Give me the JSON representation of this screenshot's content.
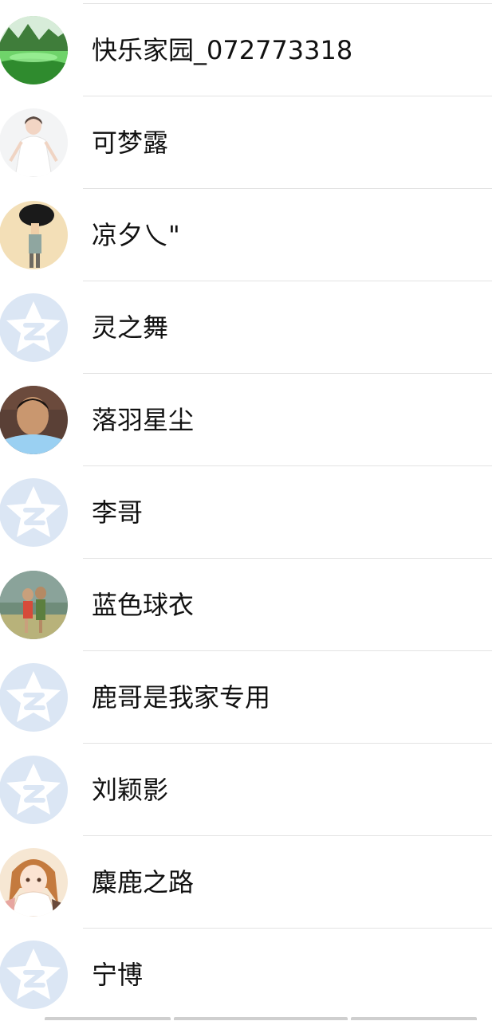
{
  "contacts": [
    {
      "name": "快乐家园_072773318",
      "avatar": "landscape-photo-avatar"
    },
    {
      "name": "可梦露",
      "avatar": "girl-white-dress-avatar"
    },
    {
      "name": "凉夕乀\"",
      "avatar": "cartoon-boy-avatar"
    },
    {
      "name": "灵之舞",
      "avatar": "default-qq-avatar"
    },
    {
      "name": "落羽星尘",
      "avatar": "man-photo-avatar"
    },
    {
      "name": "李哥",
      "avatar": "default-qq-avatar"
    },
    {
      "name": "蓝色球衣",
      "avatar": "couple-beach-avatar"
    },
    {
      "name": "鹿哥是我家专用",
      "avatar": "default-qq-avatar"
    },
    {
      "name": "刘颖影",
      "avatar": "default-qq-avatar"
    },
    {
      "name": "麋鹿之路",
      "avatar": "anime-girl-avatar"
    },
    {
      "name": "宁博",
      "avatar": "default-qq-avatar"
    }
  ],
  "colors": {
    "divider": "#e3e3e3",
    "default_avatar_bg": "#dbe6f4",
    "default_avatar_star": "#ffffff",
    "text": "#111111"
  }
}
